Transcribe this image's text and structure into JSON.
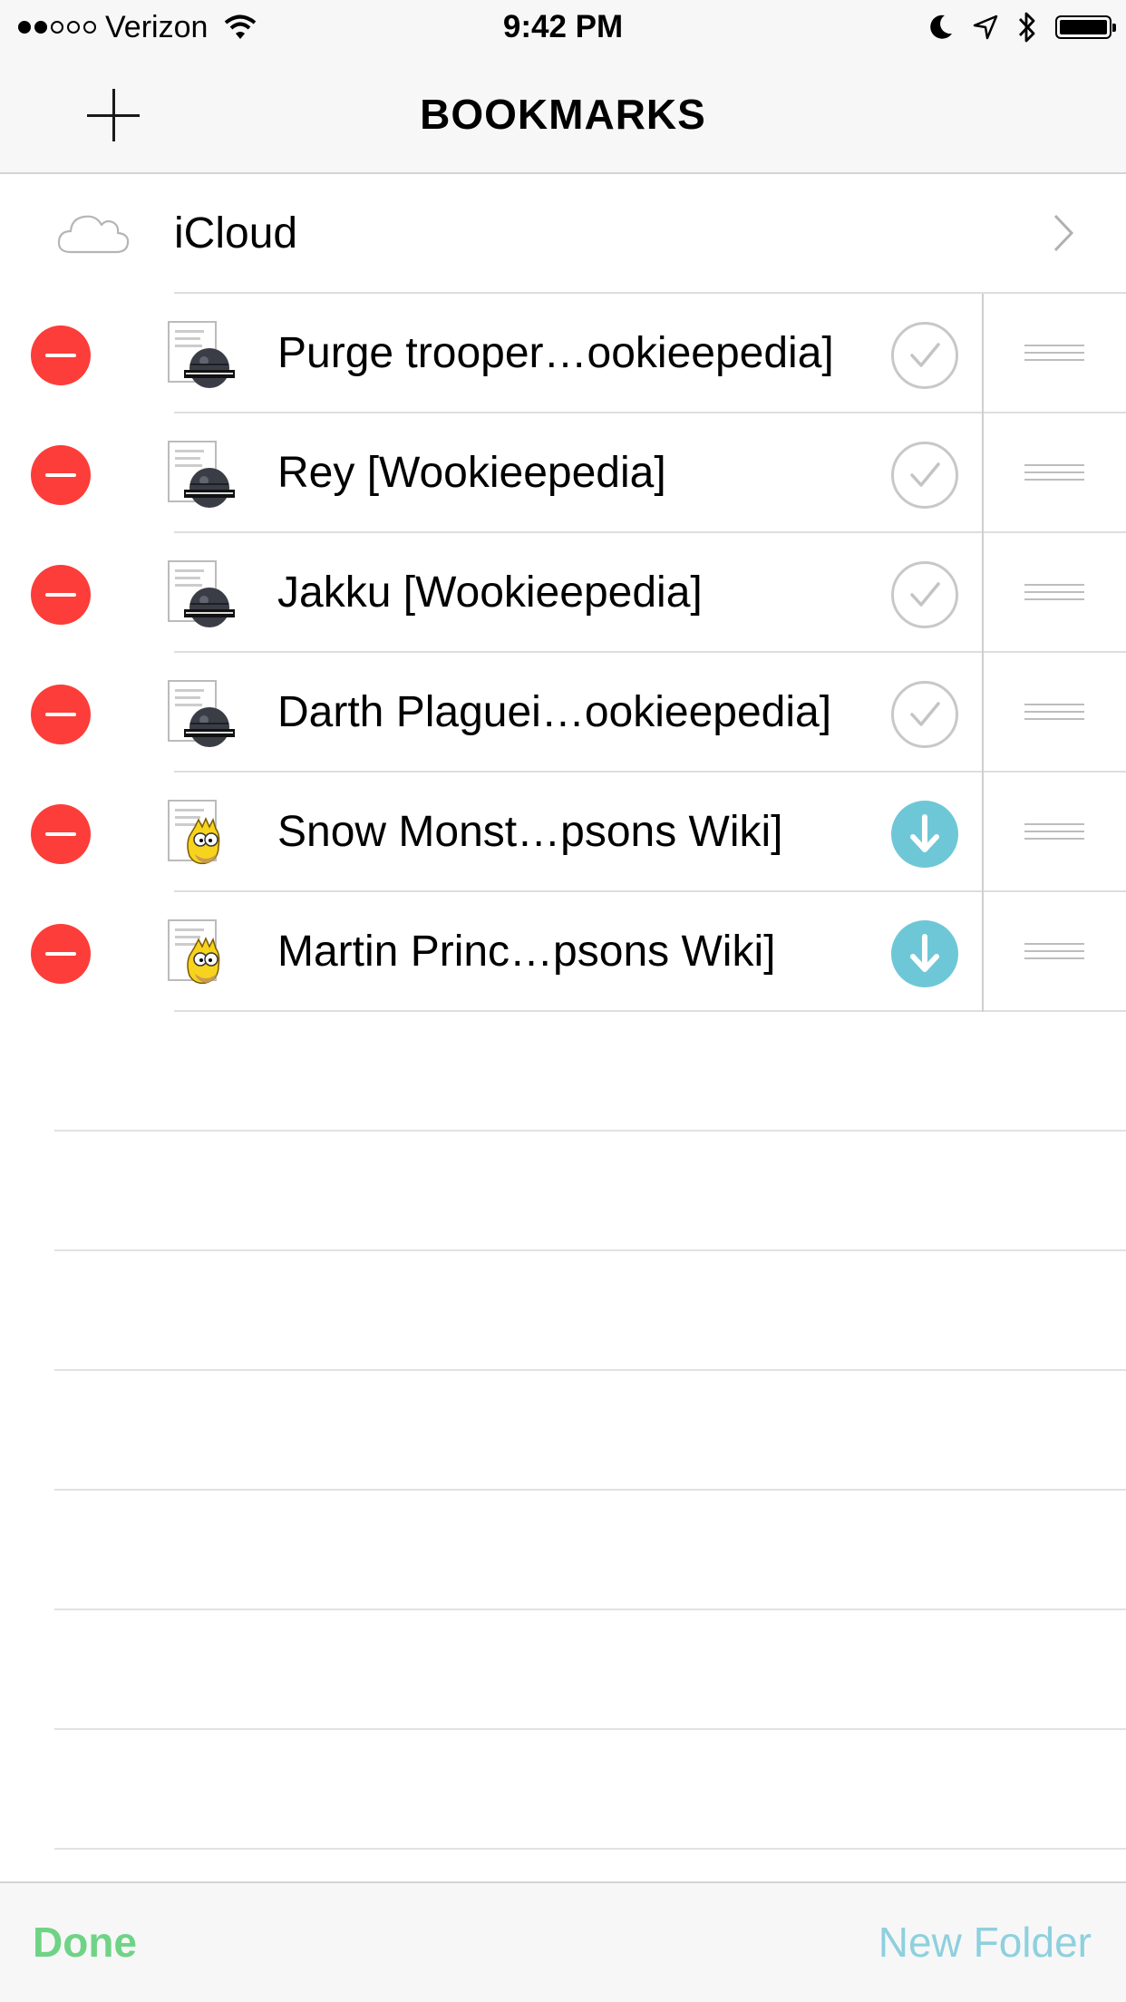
{
  "status_bar": {
    "signal_dots_filled": 2,
    "signal_dots_total": 5,
    "carrier": "Verizon",
    "time": "9:42 PM",
    "icons": [
      "wifi-icon",
      "moon-icon",
      "location-icon",
      "bluetooth-icon",
      "battery-icon"
    ]
  },
  "nav": {
    "title": "BOOKMARKS",
    "add_icon": "plus-icon"
  },
  "icloud": {
    "label": "iCloud",
    "icon": "cloud-icon"
  },
  "bookmarks": [
    {
      "title": "Purge trooper…ookieepedia]",
      "favicon": "wookieepedia-favicon",
      "status": "saved"
    },
    {
      "title": "Rey [Wookieepedia]",
      "favicon": "wookieepedia-favicon",
      "status": "saved"
    },
    {
      "title": "Jakku [Wookieepedia]",
      "favicon": "wookieepedia-favicon",
      "status": "saved"
    },
    {
      "title": "Darth Plaguei…ookieepedia]",
      "favicon": "wookieepedia-favicon",
      "status": "saved"
    },
    {
      "title": "Snow Monst…psons Wiki]",
      "favicon": "simpsons-wiki-favicon",
      "status": "download"
    },
    {
      "title": "Martin Princ…psons Wiki]",
      "favicon": "simpsons-wiki-favicon",
      "status": "download"
    }
  ],
  "toolbar": {
    "done_label": "Done",
    "new_folder_label": "New Folder"
  },
  "colors": {
    "delete_red": "#fc3d39",
    "download_teal": "#6ec7d6",
    "done_green": "#6fd386",
    "new_folder_blue": "#8ed0de"
  }
}
